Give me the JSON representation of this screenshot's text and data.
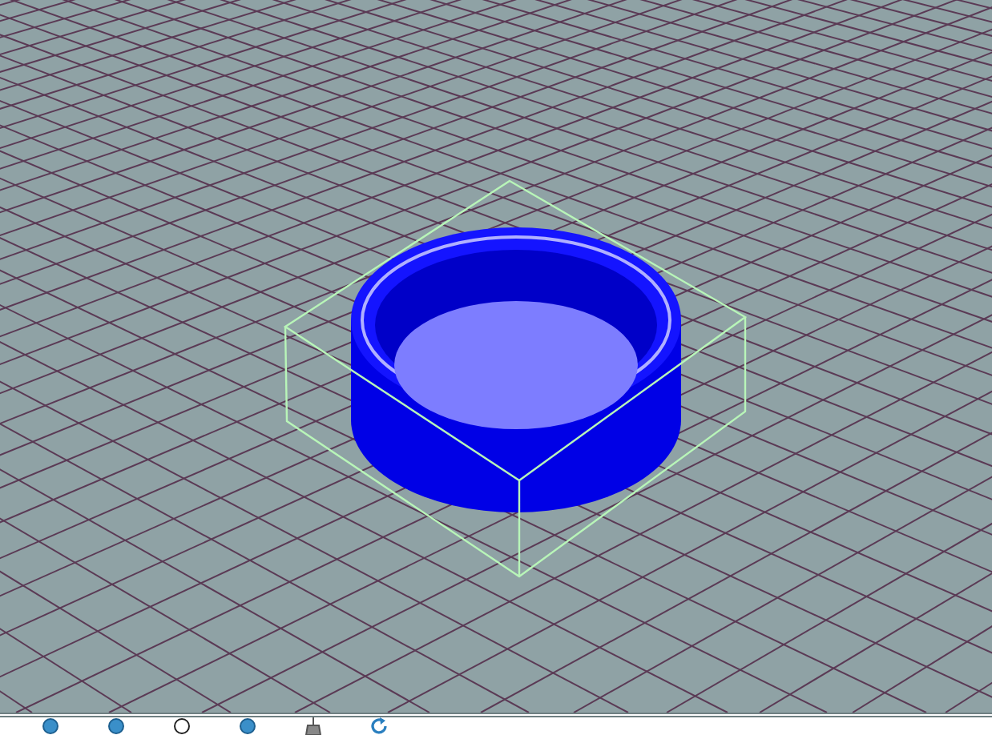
{
  "viewport": {
    "model": {
      "kind": "cup",
      "selected": true
    }
  },
  "status_bar": {
    "items": [
      {
        "kind": "radio",
        "checked": true
      },
      {
        "kind": "radio",
        "checked": true
      },
      {
        "kind": "radio",
        "checked": false
      },
      {
        "kind": "radio",
        "checked": true
      },
      {
        "kind": "broom"
      },
      {
        "kind": "refresh"
      }
    ]
  }
}
